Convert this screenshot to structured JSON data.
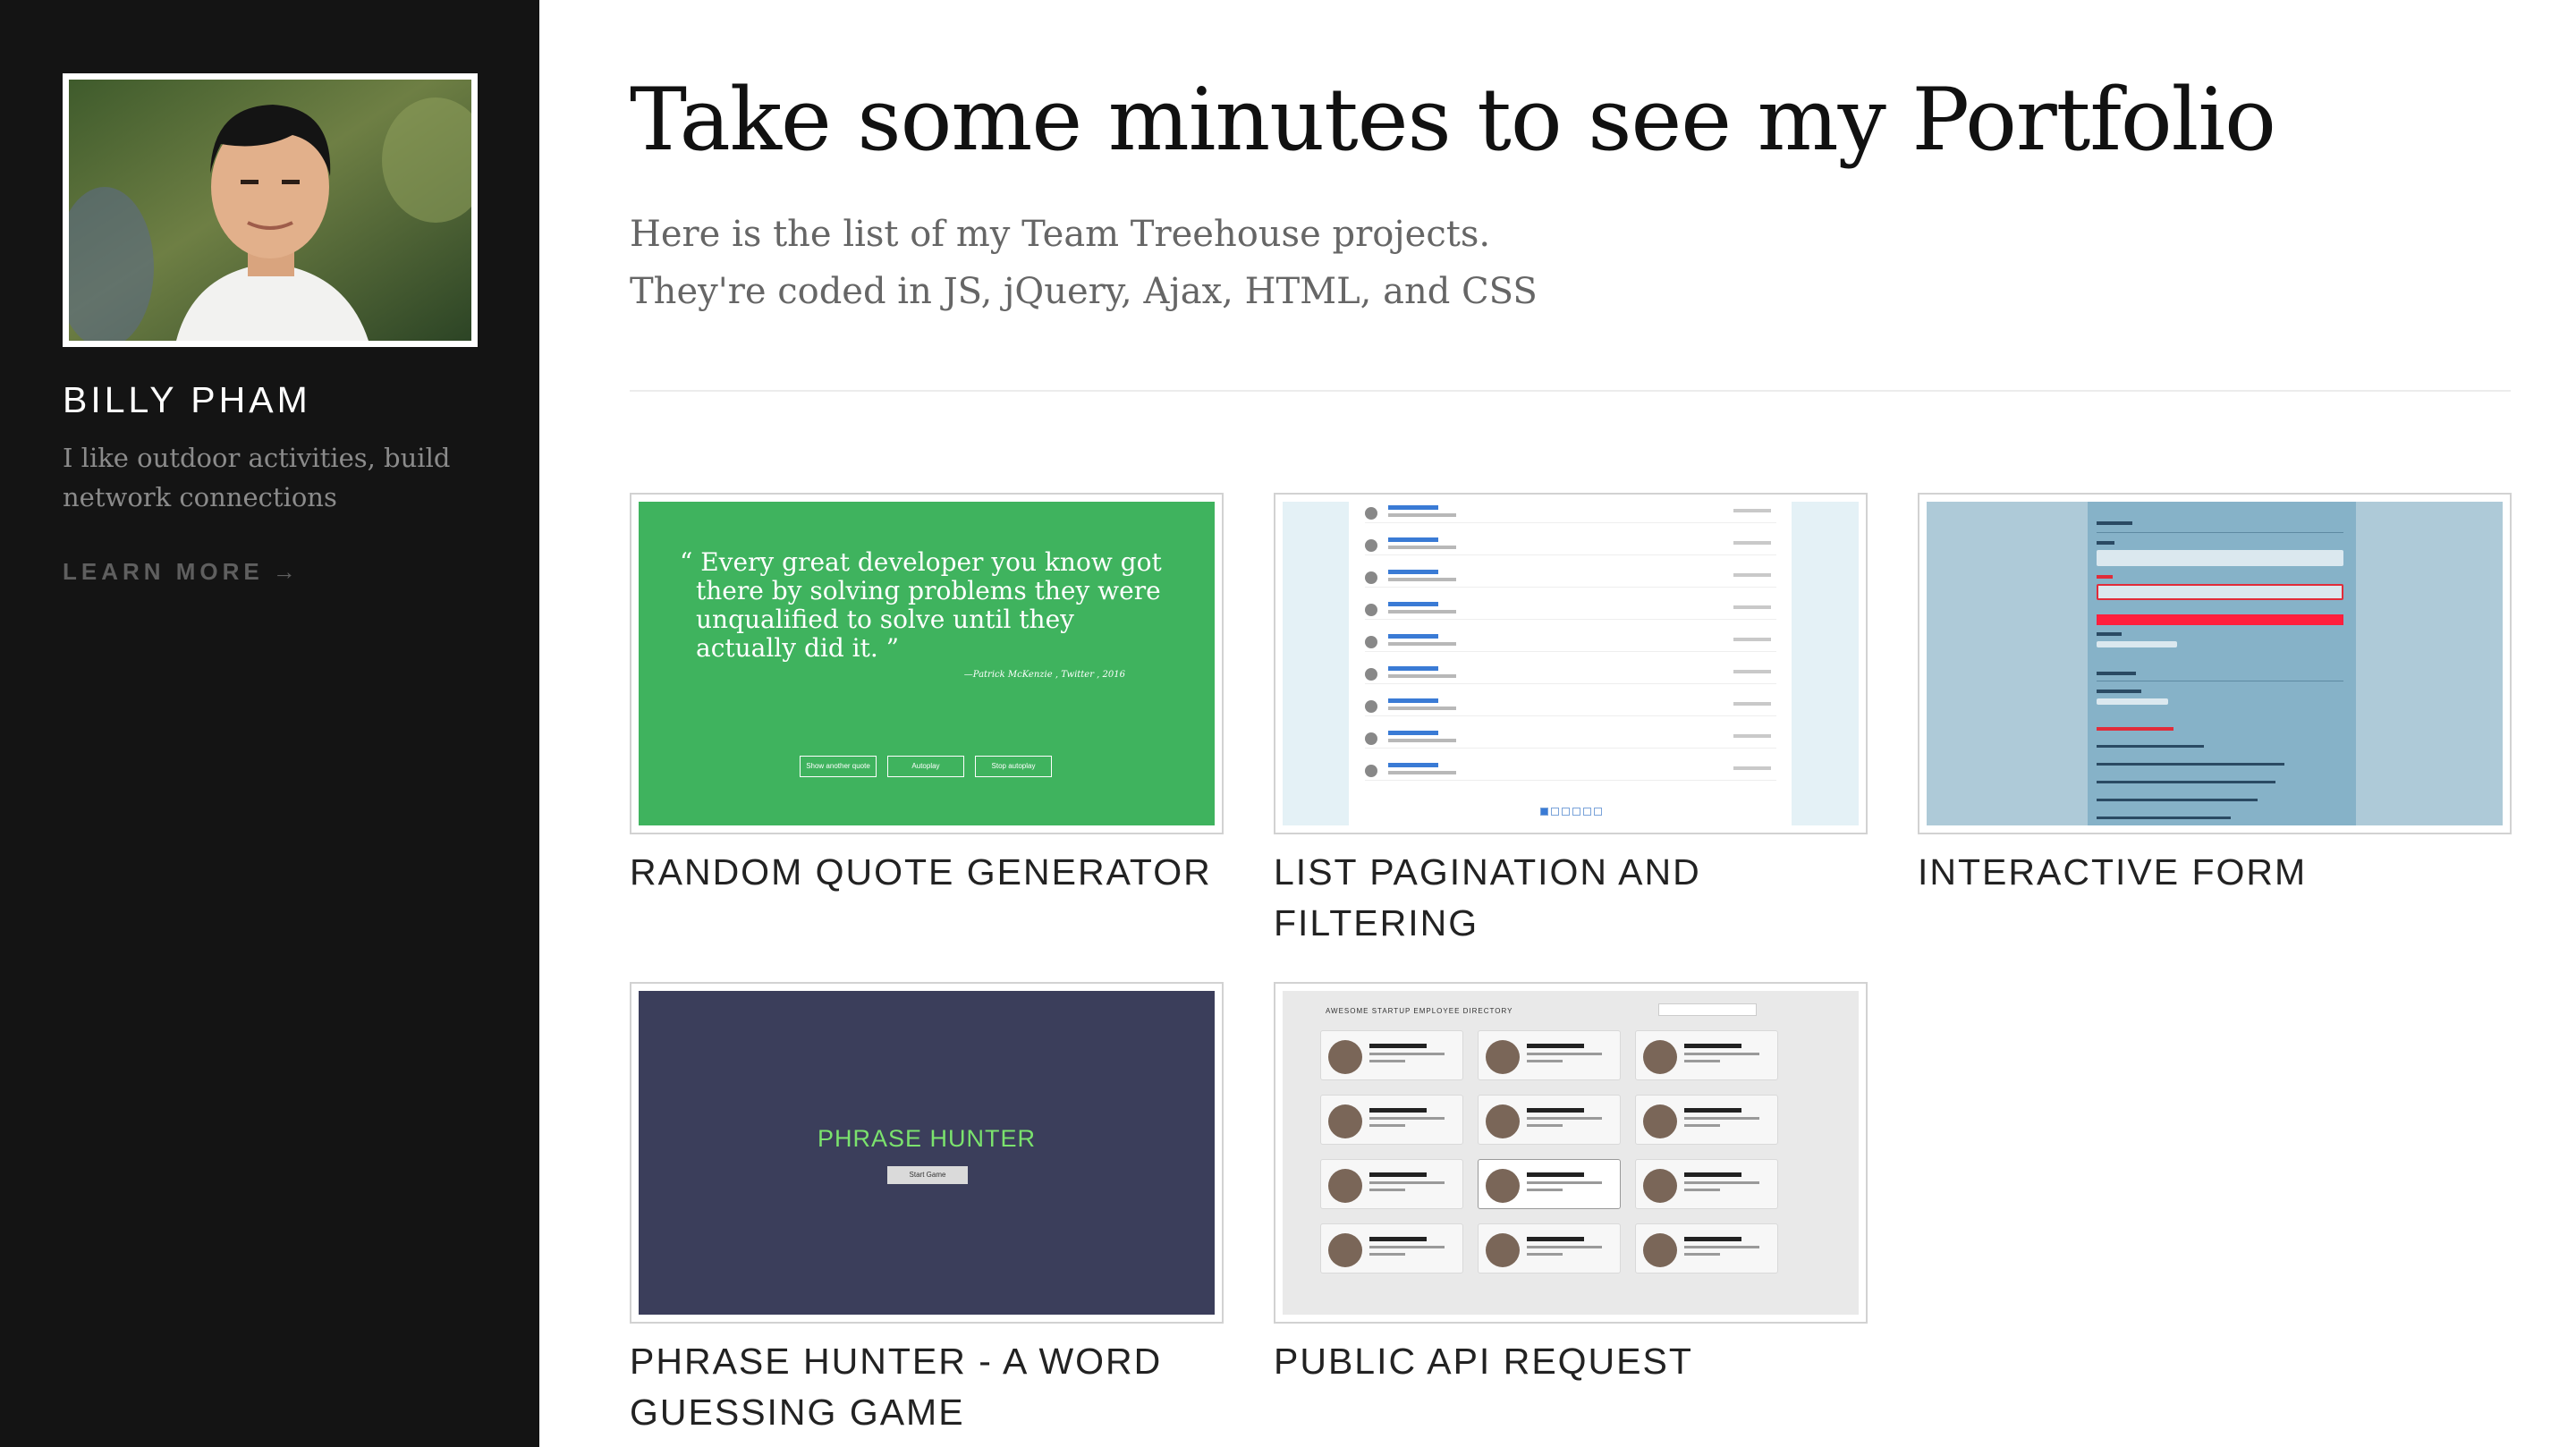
{
  "sidebar": {
    "name": "BILLY PHAM",
    "bio": "I like outdoor activities, build network connections",
    "learn_more": "LEARN MORE",
    "learn_more_arrow": "→"
  },
  "header": {
    "title": "Take some minutes to see my Portfolio",
    "subtitle_line1": "Here is the list of my Team Treehouse projects.",
    "subtitle_line2": "They're coded in JS, jQuery, Ajax, HTML, and CSS"
  },
  "projects": [
    {
      "title": "RANDOM QUOTE GENERATOR",
      "quote_text": "“ Every great developer you know got there by solving problems they were unqualified to solve until they actually did it. ”",
      "quote_source": "—Patrick McKenzie , Twitter , 2016",
      "buttons": [
        "Show another quote",
        "Autoplay",
        "Stop autoplay"
      ]
    },
    {
      "title": "LIST PAGINATION AND FILTERING"
    },
    {
      "title": "INTERACTIVE FORM"
    },
    {
      "title": "PHRASE HUNTER - A WORD GUESSING GAME",
      "game_title": "PHRASE HUNTER",
      "start_button": "Start Game"
    },
    {
      "title": "PUBLIC API REQUEST",
      "directory_heading": "AWESOME STARTUP EMPLOYEE DIRECTORY"
    }
  ],
  "colors": {
    "sidebar_bg": "#141414",
    "quote_thumb": "#3fb35e",
    "phrase_thumb": "#3b3e5b",
    "phrase_title": "#7be36d"
  }
}
